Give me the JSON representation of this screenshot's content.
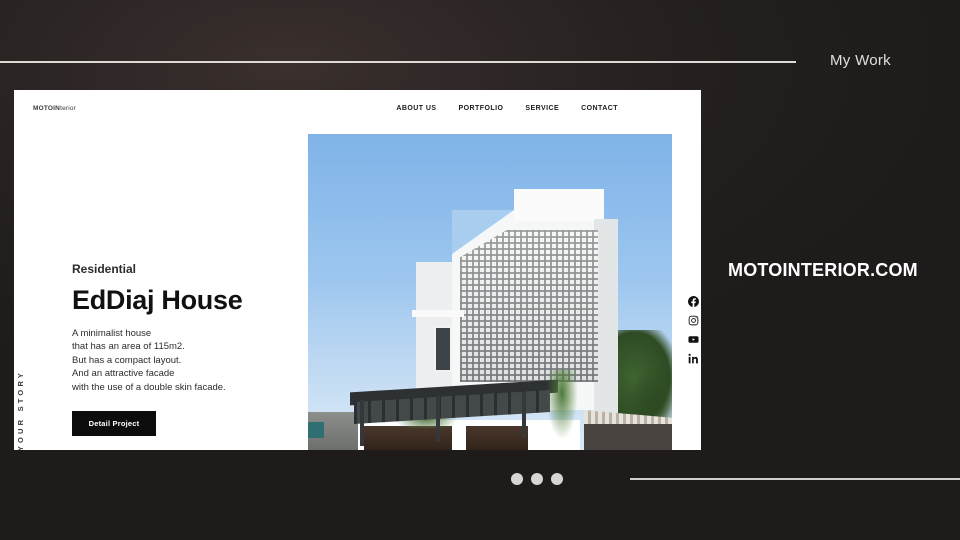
{
  "slide": {
    "label": "My Work",
    "brand_url": "MOTOINTERIOR.COM",
    "background_color": "#231f1e",
    "rule_color": "#dedad6"
  },
  "website": {
    "logo": "MOTOIN",
    "logo_suffix": "terior",
    "nav": [
      {
        "label": "ABOUT US"
      },
      {
        "label": "PORTFOLIO"
      },
      {
        "label": "SERVICE"
      },
      {
        "label": "CONTACT"
      }
    ],
    "side_label": "TELL YOUR STORY",
    "hero": {
      "kicker": "Residential",
      "headline": "EdDiaj House",
      "description_lines": [
        "A minimalist house",
        "that has an area of 115m2.",
        "But has a compact layout.",
        "And an attractive facade",
        "with the use of a double skin facade."
      ],
      "cta_label": "Detail Project",
      "cta_background": "#0c0c0c",
      "photo_alt": "White minimalist house with perforated double-skin brick facade"
    },
    "social": [
      {
        "name": "facebook-icon"
      },
      {
        "name": "instagram-icon"
      },
      {
        "name": "youtube-icon"
      },
      {
        "name": "linkedin-icon"
      }
    ]
  },
  "carousel": {
    "dots": [
      {
        "active": true
      },
      {
        "active": true
      },
      {
        "active": true
      }
    ],
    "dot_color": "#d9d6d2"
  }
}
